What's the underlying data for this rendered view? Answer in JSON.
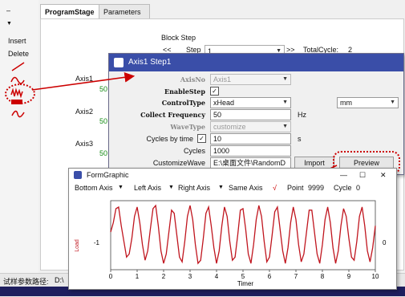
{
  "toolbar": {
    "dash": "–",
    "arrow": "▼",
    "insert_label": "Insert",
    "delete_label": "Delete"
  },
  "tabs": [
    {
      "label": "ProgramStage",
      "active": true
    },
    {
      "label": "Parameters",
      "active": false
    }
  ],
  "block_step": {
    "title": "Block Step",
    "nav_prev": "<<",
    "step_label": "Step",
    "step_value": "1",
    "nav_next": ">>",
    "total_label": "TotalCycle:",
    "total_value": "2"
  },
  "side_axes": [
    "Axis1",
    "Axis2",
    "Axis3"
  ],
  "side_values": [
    "50",
    "50",
    "50"
  ],
  "axis_dialog": {
    "title": "Axis1  Step1",
    "fields": {
      "axisno_label": "AxisNo",
      "axisno_value": "Axis1",
      "enablestep_label": "EnableStep",
      "enablestep_checked": "✓",
      "controltype_label": "ControlType",
      "controltype_value": "xHead",
      "unit_value": "mm",
      "frequency_label": "Collect Frequency",
      "frequency_value": "50",
      "frequency_unit": "Hz",
      "wavetype_label": "WaveType",
      "wavetype_value": "customize",
      "cycles_by_time_label": "Cycles by time",
      "cycles_by_time_checked": "✓",
      "cycles_by_time_value": "10",
      "cycles_by_time_unit": "s",
      "cycles_label": "Cycles",
      "cycles_value": "1000",
      "customizewave_label": "CustomizeWave",
      "customizewave_value": "E:\\桌面文件\\RandomD",
      "import_label": "Import",
      "preview_label": "Preview"
    }
  },
  "graphic_window": {
    "title": "FormGraphic",
    "minimize": "—",
    "maximize": "☐",
    "close": "✕",
    "toolbar": {
      "bottom_axis": "Bottom Axis",
      "left_axis": "Left Axis",
      "right_axis": "Right Axis",
      "same_axis": "Same Axis",
      "check": "√",
      "point_label": "Point",
      "point_value": "9999",
      "cycle_label": "Cycle",
      "cycle_value": "0"
    }
  },
  "status_bar": {
    "path_label": "试样参数路径:",
    "path_value": "D:\\"
  },
  "chart_data": {
    "type": "line",
    "xlabel": "Timer",
    "ylabel": "Load",
    "xlim": [
      0,
      10
    ],
    "x_ticks": [
      "0",
      "1",
      "2",
      "3",
      "4",
      "5",
      "6",
      "7",
      "8",
      "9",
      "10"
    ],
    "left_tick": "-1",
    "right_tick": "0",
    "series_color": "#c0151e",
    "series": [
      {
        "values": [
          0.1,
          0.4,
          0.85,
          0.9,
          0.3,
          -0.2,
          -0.7,
          -0.6,
          -0.1,
          0.6,
          0.9,
          0.4,
          -0.3,
          -0.8,
          -0.5,
          0.2,
          0.85,
          0.95,
          0.3,
          -0.5,
          -0.9,
          -0.6,
          0.1,
          0.8,
          0.7,
          0.0,
          -0.7,
          -0.85,
          -0.2,
          0.6,
          0.95,
          0.5,
          -0.3,
          -0.9,
          -0.8,
          -0.1,
          0.7,
          0.9,
          0.3,
          -0.4,
          -0.9,
          -0.5,
          0.3,
          0.9,
          0.6,
          -0.2,
          -0.8,
          -0.7,
          0.0,
          0.8,
          0.85,
          0.2,
          -0.6,
          -0.9,
          -0.3,
          0.5,
          0.95,
          0.6,
          -0.2,
          -0.85,
          -0.7,
          0.0,
          0.75,
          0.9,
          0.2,
          -0.5,
          -0.9,
          -0.4,
          0.4,
          0.9,
          0.5,
          -0.3,
          -0.85,
          -0.6,
          0.1,
          0.8,
          0.8,
          0.1,
          -0.6,
          -0.9,
          -0.3,
          0.5,
          0.9,
          0.4,
          -0.4,
          -0.9,
          -0.5,
          0.3,
          0.85,
          0.6,
          -0.1,
          -0.7,
          -0.8,
          -0.2,
          0.6,
          0.9,
          0.3,
          -0.5,
          -0.85,
          -0.4,
          0.3
        ]
      }
    ]
  }
}
